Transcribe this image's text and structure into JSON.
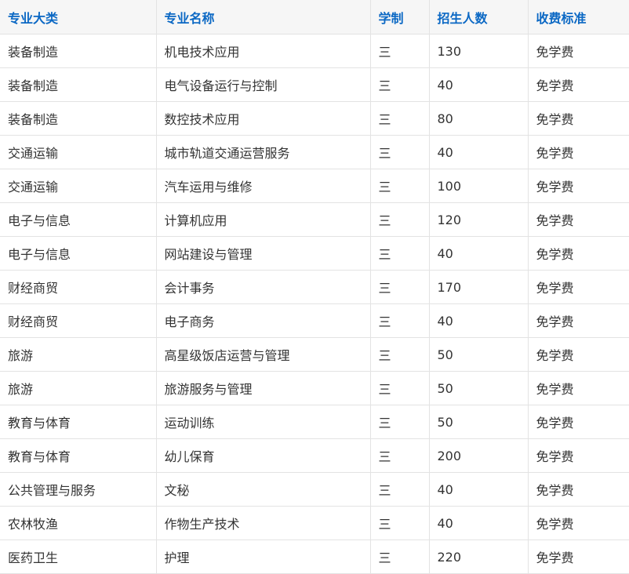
{
  "colors": {
    "header_text": "#0b68c4",
    "header_bg": "#f6f6f6",
    "cell_text": "#333333",
    "border": "#e3e3e3"
  },
  "table": {
    "headers": [
      "专业大类",
      "专业名称",
      "学制",
      "招生人数",
      "收费标准"
    ],
    "rows": [
      [
        "装备制造",
        "机电技术应用",
        "三",
        "130",
        "免学费"
      ],
      [
        "装备制造",
        "电气设备运行与控制",
        "三",
        "40",
        "免学费"
      ],
      [
        "装备制造",
        "数控技术应用",
        "三",
        "80",
        "免学费"
      ],
      [
        "交通运输",
        "城市轨道交通运营服务",
        "三",
        "40",
        "免学费"
      ],
      [
        "交通运输",
        "汽车运用与维修",
        "三",
        "100",
        "免学费"
      ],
      [
        "电子与信息",
        "计算机应用",
        "三",
        "120",
        "免学费"
      ],
      [
        "电子与信息",
        "网站建设与管理",
        "三",
        "40",
        "免学费"
      ],
      [
        "财经商贸",
        "会计事务",
        "三",
        "170",
        "免学费"
      ],
      [
        "财经商贸",
        "电子商务",
        "三",
        "40",
        "免学费"
      ],
      [
        "旅游",
        "高星级饭店运营与管理",
        "三",
        "50",
        "免学费"
      ],
      [
        "旅游",
        "旅游服务与管理",
        "三",
        "50",
        "免学费"
      ],
      [
        "教育与体育",
        "运动训练",
        "三",
        "50",
        "免学费"
      ],
      [
        "教育与体育",
        "幼儿保育",
        "三",
        "200",
        "免学费"
      ],
      [
        "公共管理与服务",
        "文秘",
        "三",
        "40",
        "免学费"
      ],
      [
        "农林牧渔",
        "作物生产技术",
        "三",
        "40",
        "免学费"
      ],
      [
        "医药卫生",
        "护理",
        "三",
        "220",
        "免学费"
      ]
    ]
  }
}
